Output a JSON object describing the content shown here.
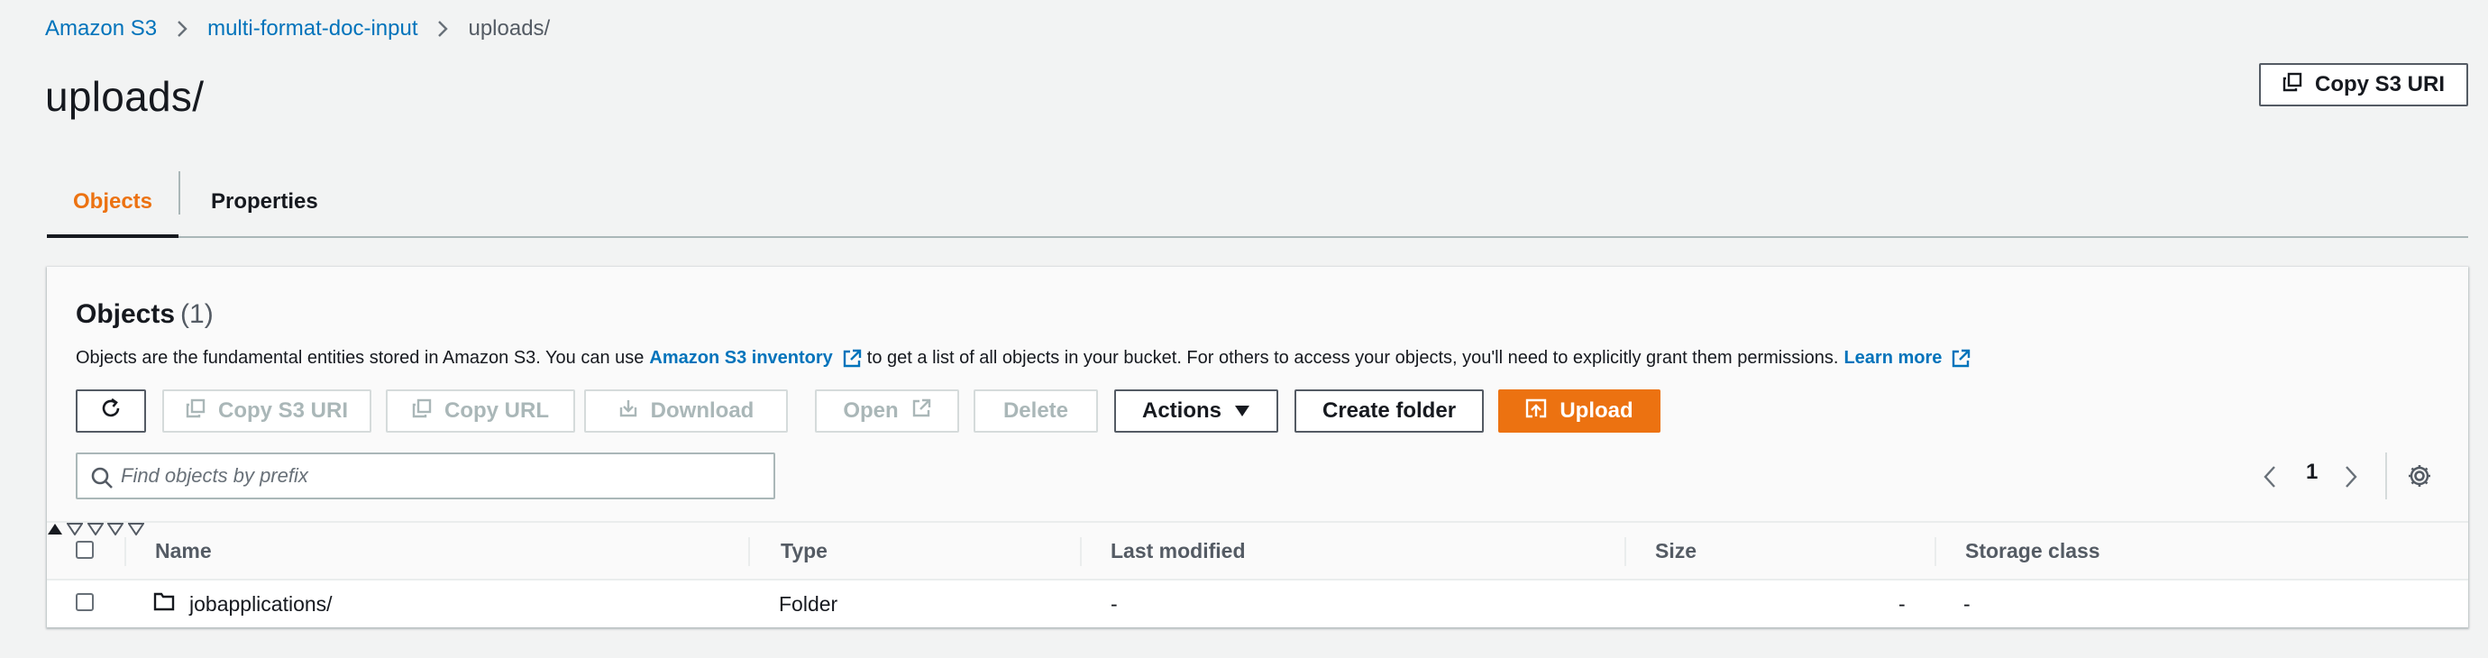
{
  "breadcrumb": {
    "items": [
      "Amazon S3",
      "multi-format-doc-input"
    ],
    "current": "uploads/"
  },
  "page": {
    "title": "uploads/",
    "copy_uri_label": "Copy S3 URI"
  },
  "tabs": [
    {
      "label": "Objects",
      "active": true
    },
    {
      "label": "Properties",
      "active": false
    }
  ],
  "objects_panel": {
    "title": "Objects",
    "count": "(1)",
    "description": {
      "before": "Objects are the fundamental entities stored in Amazon S3. You can use",
      "inventory_link": "Amazon S3 inventory",
      "middle": "to get a list of all objects in your bucket. For others to access your objects, you'll need to explicitly grant them permissions.",
      "learn_more": "Learn more"
    },
    "toolbar": {
      "refresh": "refresh-icon",
      "copy_s3_uri": "Copy S3 URI",
      "copy_url": "Copy URL",
      "download": "Download",
      "open": "Open",
      "delete": "Delete",
      "actions": "Actions",
      "create_folder": "Create folder",
      "upload": "Upload"
    },
    "search": {
      "placeholder": "Find objects by prefix",
      "value": ""
    },
    "pagination": {
      "current_page": "1"
    }
  },
  "table": {
    "columns": [
      "Name",
      "Type",
      "Last modified",
      "Size",
      "Storage class"
    ],
    "rows": [
      {
        "name": "jobapplications/",
        "type": "Folder",
        "last_modified": "-",
        "size": "-",
        "storage_class": "-"
      }
    ]
  },
  "colors": {
    "accent": "#ec7211",
    "link": "#0073bb",
    "text": "#16191f",
    "disabled": "#aab7b8"
  }
}
